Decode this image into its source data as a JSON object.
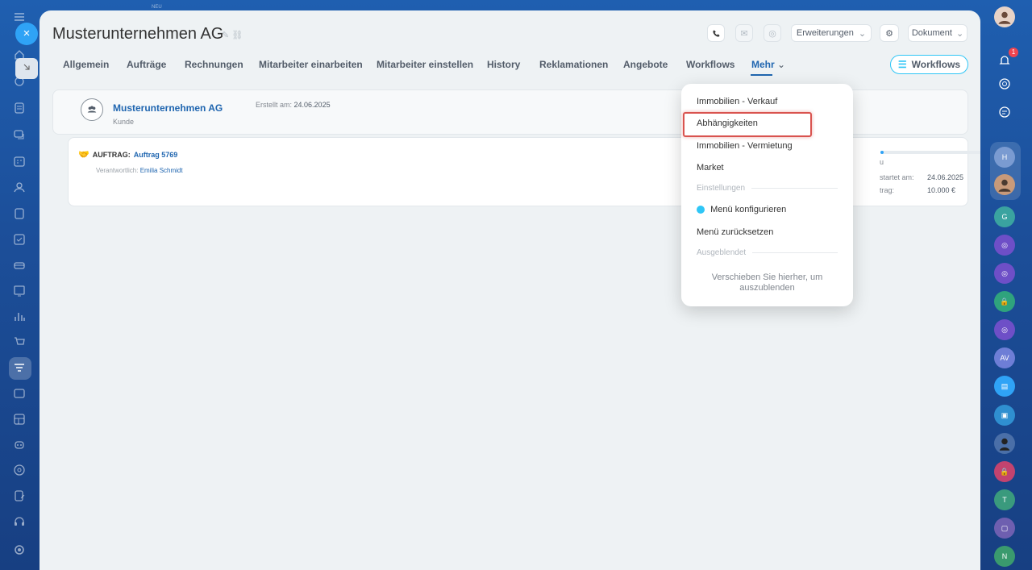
{
  "left_rail": {
    "neu_label": "NEU",
    "close_icon": "×",
    "icons": [
      "menu-icon",
      "home-icon",
      "puzzle-icon",
      "document-icon",
      "chat-icon",
      "calendar-icon",
      "contacts-icon",
      "file-icon",
      "checkbox-icon",
      "stack-icon",
      "board-icon",
      "chart-icon",
      "cart-icon",
      "filter-icon",
      "card-icon",
      "grid-icon",
      "robot-icon",
      "target-icon",
      "edit-icon",
      "headset-icon",
      "settings-icon"
    ]
  },
  "header": {
    "title": "Musterunternehmen AG",
    "extensions_label": "Erweiterungen",
    "document_label": "Dokument"
  },
  "tabs": [
    {
      "label": "Allgemein"
    },
    {
      "label": "Aufträge"
    },
    {
      "label": "Rechnungen"
    },
    {
      "label": "Mitarbeiter einarbeiten"
    },
    {
      "label": "Mitarbeiter einstellen"
    },
    {
      "label": "History"
    },
    {
      "label": "Reklamationen"
    },
    {
      "label": "Angebote"
    },
    {
      "label": "Workflows"
    },
    {
      "label": "Mehr"
    }
  ],
  "workflows_button": "Workflows",
  "company_card": {
    "name": "Musterunternehmen AG",
    "type": "Kunde",
    "created_label": "Erstellt am:",
    "created_date": "24.06.2025"
  },
  "order_card": {
    "prefix": "AUFTRAG:",
    "order_name": "Auftrag 5769",
    "responsible_label": "Verantwortlich:",
    "responsible_name": "Emilia Schmidt",
    "status_fragment": "u",
    "started_label": "startet am:",
    "started_date": "24.06.2025",
    "amount_label": "trag:",
    "amount_value": "10.000 €"
  },
  "dropdown": {
    "items": [
      "Immobilien - Verkauf",
      "Abhängigkeiten",
      "Immobilien - Vermietung",
      "Market"
    ],
    "settings_section": "Einstellungen",
    "configure_label": "Menü konfigurieren",
    "reset_label": "Menü zurücksetzen",
    "hidden_section": "Ausgeblendet",
    "hint": "Verschieben Sie hierher, um auszublenden"
  },
  "right_rail": {
    "notification_count": "1",
    "avatars": [
      {
        "initials": "H",
        "color": "#7a9bd1"
      },
      {
        "initials": "G",
        "color": "#3aa3a0"
      },
      {
        "initials": "AV",
        "color": "#6e7ed6"
      },
      {
        "initials": "T",
        "color": "#3a9a7d"
      },
      {
        "initials": "N",
        "color": "#3a9a6e"
      }
    ]
  }
}
